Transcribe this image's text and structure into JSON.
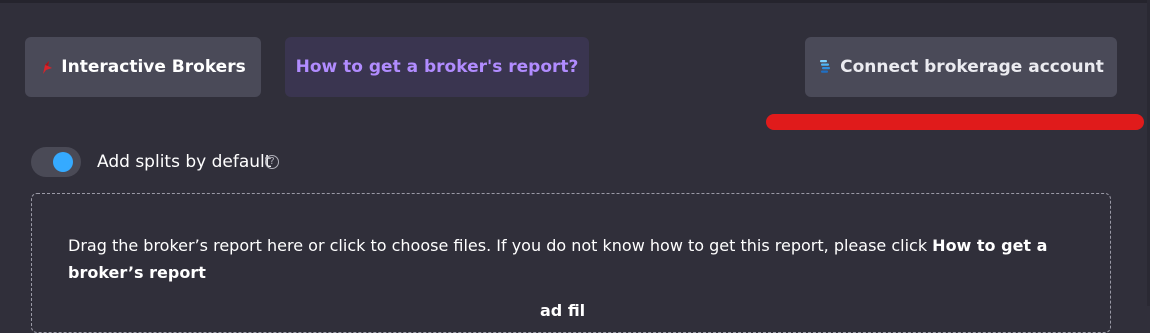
{
  "toolbar": {
    "broker_label": "Interactive Brokers",
    "broker_icon": "interactive-brokers-logo",
    "howto_label": "How to get a broker's report?",
    "connect_label": "Connect brokerage account",
    "connect_icon": "brokerage-connect-logo"
  },
  "options": {
    "add_splits_label": "Add splits by default",
    "add_splits_enabled": true,
    "help_glyph": "?"
  },
  "dropzone": {
    "instruction_text": "Drag the broker’s report here or click to choose files. If you do not know how to get this report, please click ",
    "instruction_link": "How to get a broker’s report",
    "partial_bold": "ad fil"
  },
  "colors": {
    "background": "#302f3a",
    "button": "#4a4a58",
    "howto_button": "#3a3550",
    "howto_text": "#b18cff",
    "toggle_knob": "#35aaff",
    "annotation_underline": "#e01b1b"
  }
}
